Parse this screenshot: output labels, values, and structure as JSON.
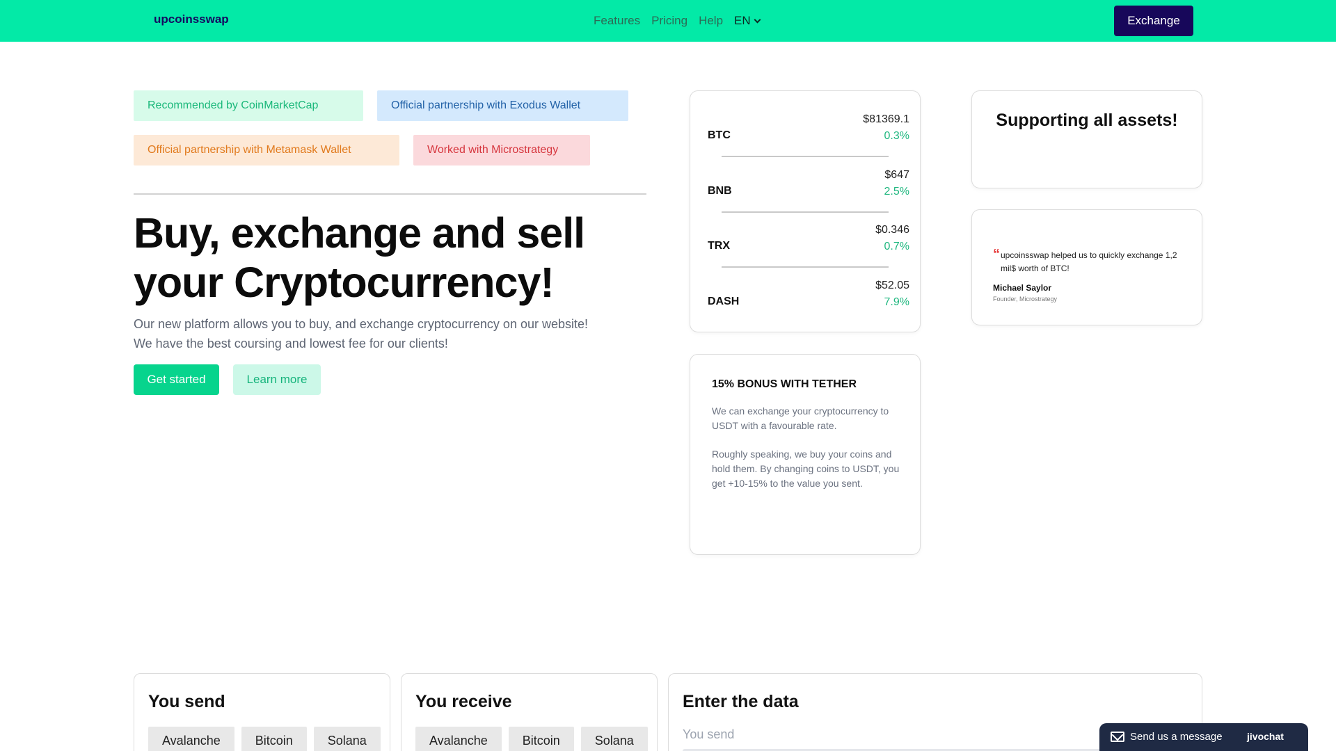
{
  "header": {
    "brand": "upcoinsswap",
    "nav": [
      "Features",
      "Pricing",
      "Help"
    ],
    "language": "EN",
    "exchange_label": "Exchange"
  },
  "badges": {
    "coinmarketcap": "Recommended by CoinMarketCap",
    "exodus": "Official partnership with Exodus Wallet",
    "metamask": "Official partnership with Metamask Wallet",
    "microstrategy": "Worked with Microstrategy"
  },
  "hero": {
    "title_line1": "Buy, exchange and sell",
    "title_line2": "your Cryptocurrency!",
    "subtitle_line1": "Our new platform allows you to buy, and exchange cryptocurrency on our website!",
    "subtitle_line2": "We have the best coursing and lowest fee for our clients!",
    "get_started": "Get started",
    "learn_more": "Learn more"
  },
  "prices": [
    {
      "symbol": "BTC",
      "price": "$81369.1",
      "change": "0.3%"
    },
    {
      "symbol": "BNB",
      "price": "$647",
      "change": "2.5%"
    },
    {
      "symbol": "TRX",
      "price": "$0.346",
      "change": "0.7%"
    },
    {
      "symbol": "DASH",
      "price": "$52.05",
      "change": "7.9%"
    }
  ],
  "assets_card": {
    "title": "Supporting all assets!"
  },
  "testimonial": {
    "quote_mark": "“",
    "quote": "upcoinsswap helped us to quickly exchange 1,2 mil$ worth of BTC!",
    "author": "Michael Saylor",
    "role": "Founder, Microstrategy"
  },
  "bonus": {
    "title": "15% BONUS WITH TETHER",
    "paragraph1": "We can exchange your cryptocurrency to USDT with a favourable rate.",
    "paragraph2": "Roughly speaking, we buy your coins and hold them. By changing coins to USDT, you get +10-15% to the value you sent."
  },
  "send_panel": {
    "title": "You send",
    "coins": [
      "Avalanche",
      "Bitcoin",
      "Solana"
    ]
  },
  "receive_panel": {
    "title": "You receive",
    "coins": [
      "Avalanche",
      "Bitcoin",
      "Solana"
    ]
  },
  "data_panel": {
    "title": "Enter the data",
    "field_label": "You send"
  },
  "chat": {
    "label": "Send us a message",
    "brand": "jivochat"
  },
  "colors": {
    "header_bg": "#03eaa7",
    "brand_navy": "#17075a",
    "accent_green": "#07d48d",
    "positive_change": "#1fb77f"
  }
}
